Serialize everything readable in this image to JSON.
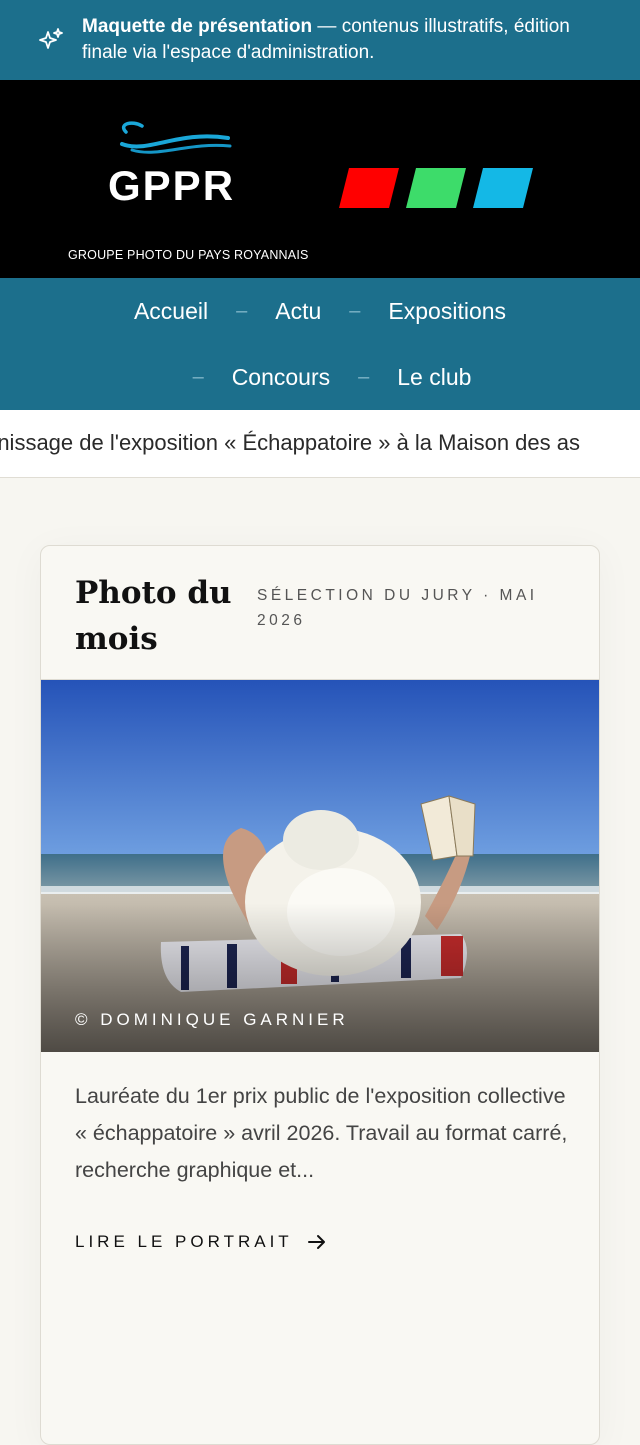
{
  "notice": {
    "strong": "Maquette de présentation",
    "text": " — contenus illustratifs, édition finale via l'espace d'administration.",
    "icon": "sparkle-icon"
  },
  "header": {
    "logo_text": "GPPR",
    "logo_subtitle": "GROUPE PHOTO DU PAYS ROYANNAIS",
    "bar_colors": [
      "#ff0000",
      "#3ddc6a",
      "#14b8e6"
    ]
  },
  "nav": {
    "row1": [
      "Accueil",
      "Actu",
      "Expositions"
    ],
    "row2": [
      "Concours",
      "Le club"
    ],
    "separator": "–"
  },
  "ticker": {
    "text": "rnissage de l'exposition « Échappatoire » à la Maison des as"
  },
  "card": {
    "title": "Photo du mois",
    "meta": "SÉLECTION DU JURY · MAI 2026",
    "credit": "© DOMINIQUE GARNIER",
    "description": "Lauréate du 1er prix public de l'exposition collective « échappatoire » avril 2026. Travail au format carré, recherche graphique et...",
    "cta": "LIRE LE PORTRAIT"
  },
  "colors": {
    "accent": "#1c6f8c",
    "header_bg": "#000000",
    "page_bg": "#f7f6f1"
  }
}
